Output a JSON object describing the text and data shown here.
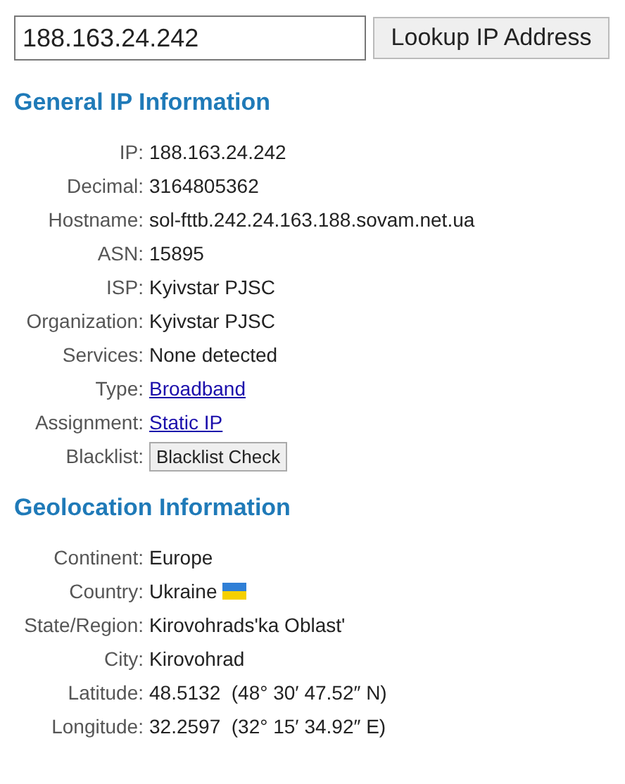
{
  "search": {
    "value": "188.163.24.242",
    "button": "Lookup IP Address"
  },
  "sections": [
    {
      "title": "General IP Information",
      "rows": [
        {
          "label": "IP:",
          "value": "188.163.24.242",
          "kind": "text"
        },
        {
          "label": "Decimal:",
          "value": "3164805362",
          "kind": "text"
        },
        {
          "label": "Hostname:",
          "value": "sol-fttb.242.24.163.188.sovam.net.ua",
          "kind": "text"
        },
        {
          "label": "ASN:",
          "value": "15895",
          "kind": "text"
        },
        {
          "label": "ISP:",
          "value": "Kyivstar PJSC",
          "kind": "text"
        },
        {
          "label": "Organization:",
          "value": "Kyivstar PJSC",
          "kind": "text"
        },
        {
          "label": "Services:",
          "value": "None detected",
          "kind": "text"
        },
        {
          "label": "Type:",
          "value": "Broadband",
          "kind": "link"
        },
        {
          "label": "Assignment:",
          "value": "Static IP",
          "kind": "link"
        },
        {
          "label": "Blacklist:",
          "value": "Blacklist Check",
          "kind": "button"
        }
      ]
    },
    {
      "title": "Geolocation Information",
      "rows": [
        {
          "label": "Continent:",
          "value": "Europe",
          "kind": "text"
        },
        {
          "label": "Country:",
          "value": "Ukraine",
          "kind": "flag"
        },
        {
          "label": "State/Region:",
          "value": "Kirovohrads'ka Oblast'",
          "kind": "text"
        },
        {
          "label": "City:",
          "value": "Kirovohrad",
          "kind": "text"
        },
        {
          "label": "Latitude:",
          "value": "48.5132  (48° 30′ 47.52″ N)",
          "kind": "text"
        },
        {
          "label": "Longitude:",
          "value": "32.2597  (32° 15′ 34.92″ E)",
          "kind": "text"
        }
      ]
    }
  ]
}
